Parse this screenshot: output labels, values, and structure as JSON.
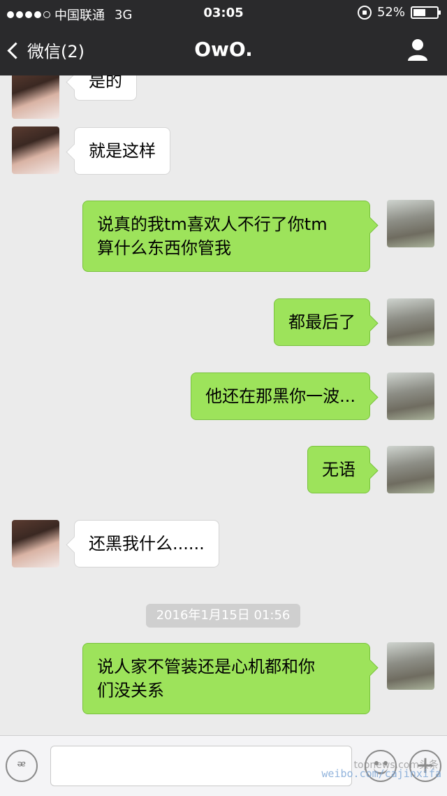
{
  "status_bar": {
    "carrier": "中国联通",
    "network": "3G",
    "time": "03:05",
    "battery": "52%",
    "battery_level": 0.52
  },
  "nav": {
    "back_label": "微信(2)",
    "title": "OwO."
  },
  "messages": [
    {
      "side": "in",
      "text": "是的"
    },
    {
      "side": "in",
      "text": "就是这样"
    },
    {
      "side": "out",
      "lines": [
        "说真的我tm喜欢人不行了你tm",
        "算什么东西你管我"
      ]
    },
    {
      "side": "out",
      "text": "都最后了"
    },
    {
      "side": "out",
      "text": "他还在那黑你一波..."
    },
    {
      "side": "out",
      "text": "无语"
    },
    {
      "side": "in",
      "text": "还黑我什么......"
    },
    {
      "timestamp": "2016年1月15日 01:56"
    },
    {
      "side": "out",
      "lines": [
        "说人家不管装还是心机都和你",
        "们没关系"
      ]
    }
  ],
  "input": {
    "placeholder": ""
  },
  "watermark": {
    "line1": "topnews.com头条",
    "line2": "weibo.com/cajinxifa"
  },
  "colors": {
    "outgoing_bubble": "#9de35b",
    "incoming_bubble": "#ffffff",
    "bar": "#2a2a2c"
  }
}
